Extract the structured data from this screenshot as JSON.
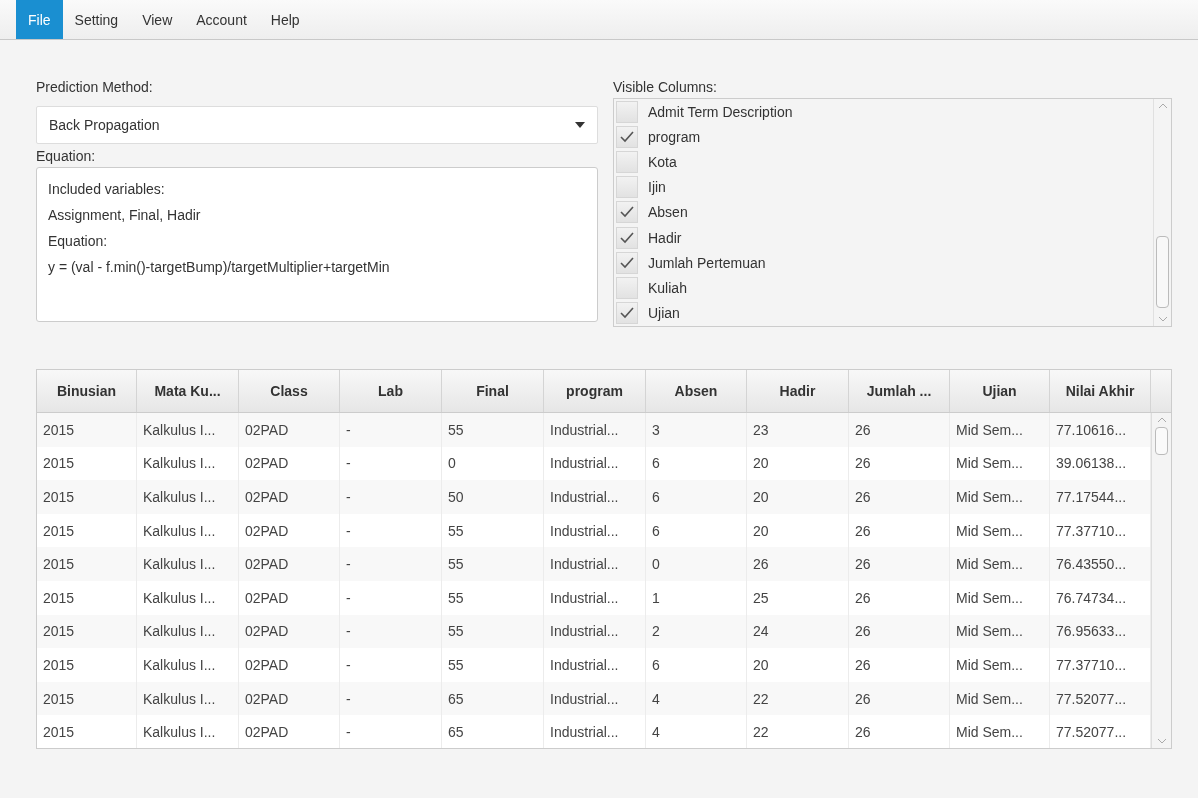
{
  "menu": [
    {
      "label": "File",
      "selected": true
    },
    {
      "label": "Setting",
      "selected": false
    },
    {
      "label": "View",
      "selected": false
    },
    {
      "label": "Account",
      "selected": false
    },
    {
      "label": "Help",
      "selected": false
    }
  ],
  "prediction": {
    "label": "Prediction Method:",
    "value": "Back Propagation"
  },
  "equation": {
    "label": "Equation:",
    "lines": [
      "Included variables:",
      "Assignment, Final, Hadir",
      "Equation:",
      "y = (val - f.min()-targetBump)/targetMultiplier+targetMin"
    ]
  },
  "visible_columns": {
    "label": "Visible Columns:",
    "items": [
      {
        "label": "Admit Term Description",
        "checked": false
      },
      {
        "label": "program",
        "checked": true
      },
      {
        "label": "Kota",
        "checked": false
      },
      {
        "label": "Ijin",
        "checked": false
      },
      {
        "label": "Absen",
        "checked": true
      },
      {
        "label": "Hadir",
        "checked": true
      },
      {
        "label": "Jumlah Pertemuan",
        "checked": true
      },
      {
        "label": "Kuliah",
        "checked": false
      },
      {
        "label": "Ujian",
        "checked": true
      }
    ]
  },
  "table": {
    "columns": [
      "Binusian",
      "Mata Ku...",
      "Class",
      "Lab",
      "Final",
      "program",
      "Absen",
      "Hadir",
      "Jumlah ...",
      "Ujian",
      "Nilai Akhir"
    ],
    "rows": [
      [
        "2015",
        "Kalkulus I...",
        "02PAD",
        "-",
        "55",
        "Industrial...",
        "3",
        "23",
        "26",
        "Mid Sem...",
        "77.10616..."
      ],
      [
        "2015",
        "Kalkulus I...",
        "02PAD",
        "-",
        "0",
        "Industrial...",
        "6",
        "20",
        "26",
        "Mid Sem...",
        "39.06138..."
      ],
      [
        "2015",
        "Kalkulus I...",
        "02PAD",
        "-",
        "50",
        "Industrial...",
        "6",
        "20",
        "26",
        "Mid Sem...",
        "77.17544..."
      ],
      [
        "2015",
        "Kalkulus I...",
        "02PAD",
        "-",
        "55",
        "Industrial...",
        "6",
        "20",
        "26",
        "Mid Sem...",
        "77.37710..."
      ],
      [
        "2015",
        "Kalkulus I...",
        "02PAD",
        "-",
        "55",
        "Industrial...",
        "0",
        "26",
        "26",
        "Mid Sem...",
        "76.43550..."
      ],
      [
        "2015",
        "Kalkulus I...",
        "02PAD",
        "-",
        "55",
        "Industrial...",
        "1",
        "25",
        "26",
        "Mid Sem...",
        "76.74734..."
      ],
      [
        "2015",
        "Kalkulus I...",
        "02PAD",
        "-",
        "55",
        "Industrial...",
        "2",
        "24",
        "26",
        "Mid Sem...",
        "76.95633..."
      ],
      [
        "2015",
        "Kalkulus I...",
        "02PAD",
        "-",
        "55",
        "Industrial...",
        "6",
        "20",
        "26",
        "Mid Sem...",
        "77.37710..."
      ],
      [
        "2015",
        "Kalkulus I...",
        "02PAD",
        "-",
        "65",
        "Industrial...",
        "4",
        "22",
        "26",
        "Mid Sem...",
        "77.52077..."
      ],
      [
        "2015",
        "Kalkulus I...",
        "02PAD",
        "-",
        "65",
        "Industrial...",
        "4",
        "22",
        "26",
        "Mid Sem...",
        "77.52077..."
      ]
    ]
  }
}
